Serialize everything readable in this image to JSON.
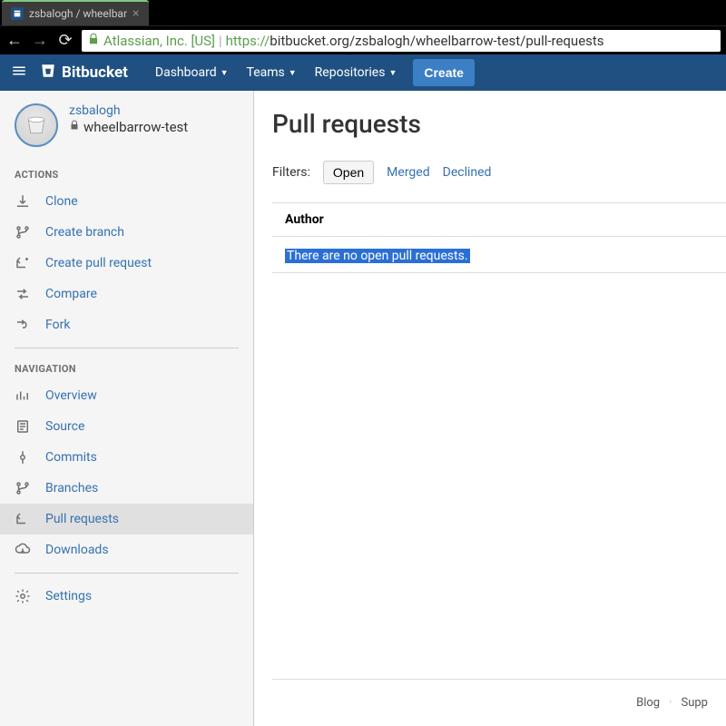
{
  "browser": {
    "tab_title": "zsbalogh / wheelbar",
    "address": {
      "company": "Atlassian, Inc. [US]",
      "protocol": "https://",
      "url": "bitbucket.org/zsbalogh/wheelbarrow-test/pull-requests"
    }
  },
  "topnav": {
    "brand": "Bitbucket",
    "items": [
      "Dashboard",
      "Teams",
      "Repositories"
    ],
    "create": "Create"
  },
  "sidebar": {
    "owner": "zsbalogh",
    "repo": "wheelbarrow-test",
    "sections": {
      "actions": {
        "title": "ACTIONS",
        "items": [
          "Clone",
          "Create branch",
          "Create pull request",
          "Compare",
          "Fork"
        ]
      },
      "navigation": {
        "title": "NAVIGATION",
        "items": [
          "Overview",
          "Source",
          "Commits",
          "Branches",
          "Pull requests",
          "Downloads"
        ]
      },
      "settings": "Settings"
    }
  },
  "content": {
    "title": "Pull requests",
    "filters": {
      "label": "Filters:",
      "open": "Open",
      "merged": "Merged",
      "declined": "Declined"
    },
    "table": {
      "header": "Author",
      "empty": "There are no open pull requests."
    }
  },
  "footer": {
    "blog": "Blog",
    "support": "Supp"
  }
}
